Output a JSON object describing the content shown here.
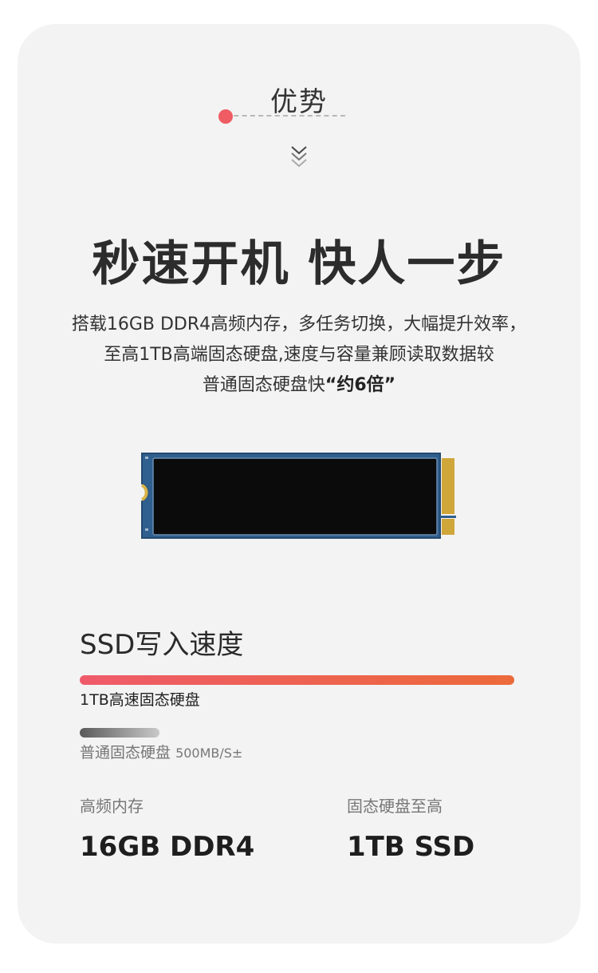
{
  "section": {
    "title": "优势"
  },
  "headline": "秒速开机 快人一步",
  "description": {
    "line1": "搭载16GB DDR4高频内存，多任务切换，大幅提升效率，",
    "line2": "至高1TB高端固态硬盘,速度与容量兼顾读取数据较",
    "line3_prefix": "普通固态硬盘快",
    "line3_highlight": "“约6倍”"
  },
  "speed": {
    "title": "SSD写入速度",
    "fast_label": "1TB高速固态硬盘",
    "slow_label": "普通固态硬盘",
    "slow_speed": "500MB/S±"
  },
  "specs": [
    {
      "label": "高频内存",
      "value": "16GB DDR4"
    },
    {
      "label": "固态硬盘至高",
      "value": "1TB SSD"
    }
  ],
  "colors": {
    "accent_red": "#ef5c63",
    "accent_orange": "#ec6a3a",
    "card_bg": "#f3f3f3"
  }
}
